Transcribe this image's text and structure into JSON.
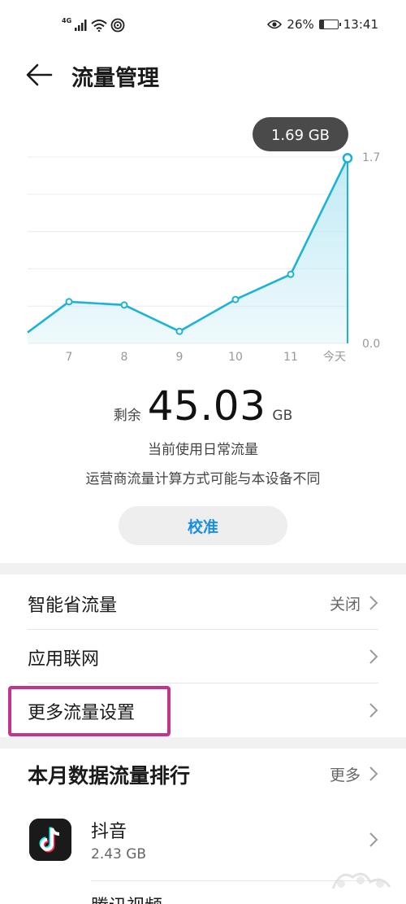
{
  "status_bar": {
    "network": "4G",
    "battery": "26%",
    "battery_level": 0.26,
    "time": "13:41"
  },
  "header": {
    "title": "流量管理"
  },
  "chart_data": {
    "type": "area",
    "categories": [
      "7",
      "8",
      "9",
      "10",
      "11",
      "今天"
    ],
    "leading_value": 0.1,
    "values": [
      0.38,
      0.35,
      0.11,
      0.4,
      0.63,
      1.69
    ],
    "ylim": [
      0,
      1.7
    ],
    "y_ticks": [
      "1.7",
      "0.0"
    ],
    "tooltip": "1.69 GB",
    "line_color": "#1cb3d6",
    "fill_color": "#bfe9f5"
  },
  "summary": {
    "remaining_label": "剩余",
    "remaining_value": "45.03",
    "remaining_unit": "GB",
    "usage_type": "当前使用日常流量",
    "carrier_note": "运营商流量计算方式可能与本设备不同",
    "calibrate_label": "校准"
  },
  "settings": {
    "smart_saver_label": "智能省流量",
    "smart_saver_value": "关闭",
    "app_network_label": "应用联网",
    "more_settings_label": "更多流量设置"
  },
  "ranking": {
    "title": "本月数据流量排行",
    "more_label": "更多",
    "apps": [
      {
        "name": "抖音",
        "usage": "2.43 GB"
      },
      {
        "name": "腾讯视频"
      }
    ]
  },
  "colors": {
    "accent": "#1a8fe0",
    "highlight": "#c2348f"
  }
}
